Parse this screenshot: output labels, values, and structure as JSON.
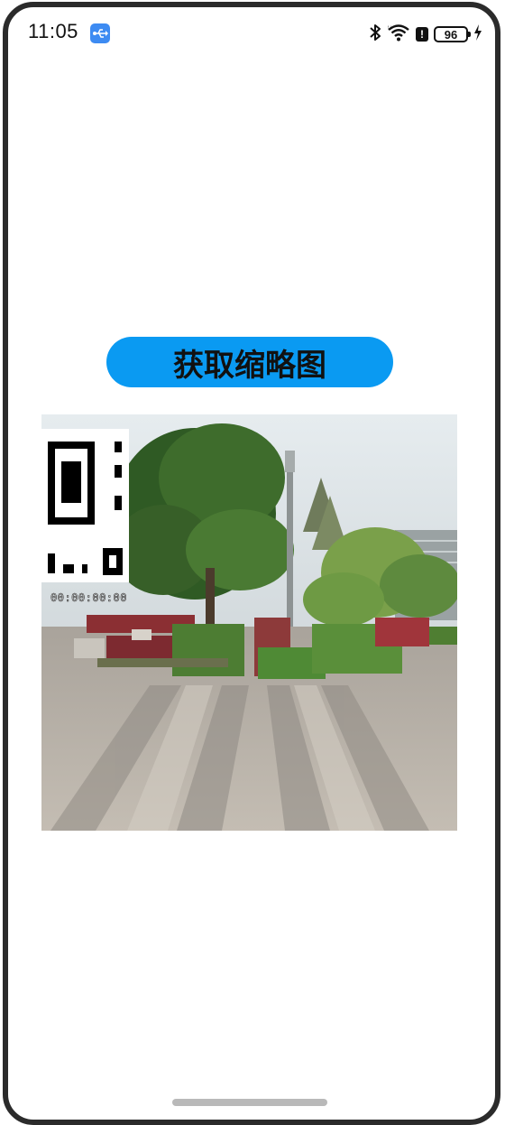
{
  "status_bar": {
    "time": "11:05",
    "battery_level": "96",
    "alert_symbol": "!",
    "icons": [
      "usb-icon",
      "bluetooth-icon",
      "wifi-icon",
      "alert-icon",
      "battery-icon",
      "charging-icon"
    ]
  },
  "main": {
    "button_label": "获取缩略图",
    "thumbnail": {
      "timestamp": "00:00:00:00",
      "overlay": "qr-code",
      "scene": "park-plaza-with-trees"
    }
  },
  "colors": {
    "button": "#0a9af2",
    "usb_badge": "#3d8bf2",
    "frame": "#2b2b2b"
  }
}
